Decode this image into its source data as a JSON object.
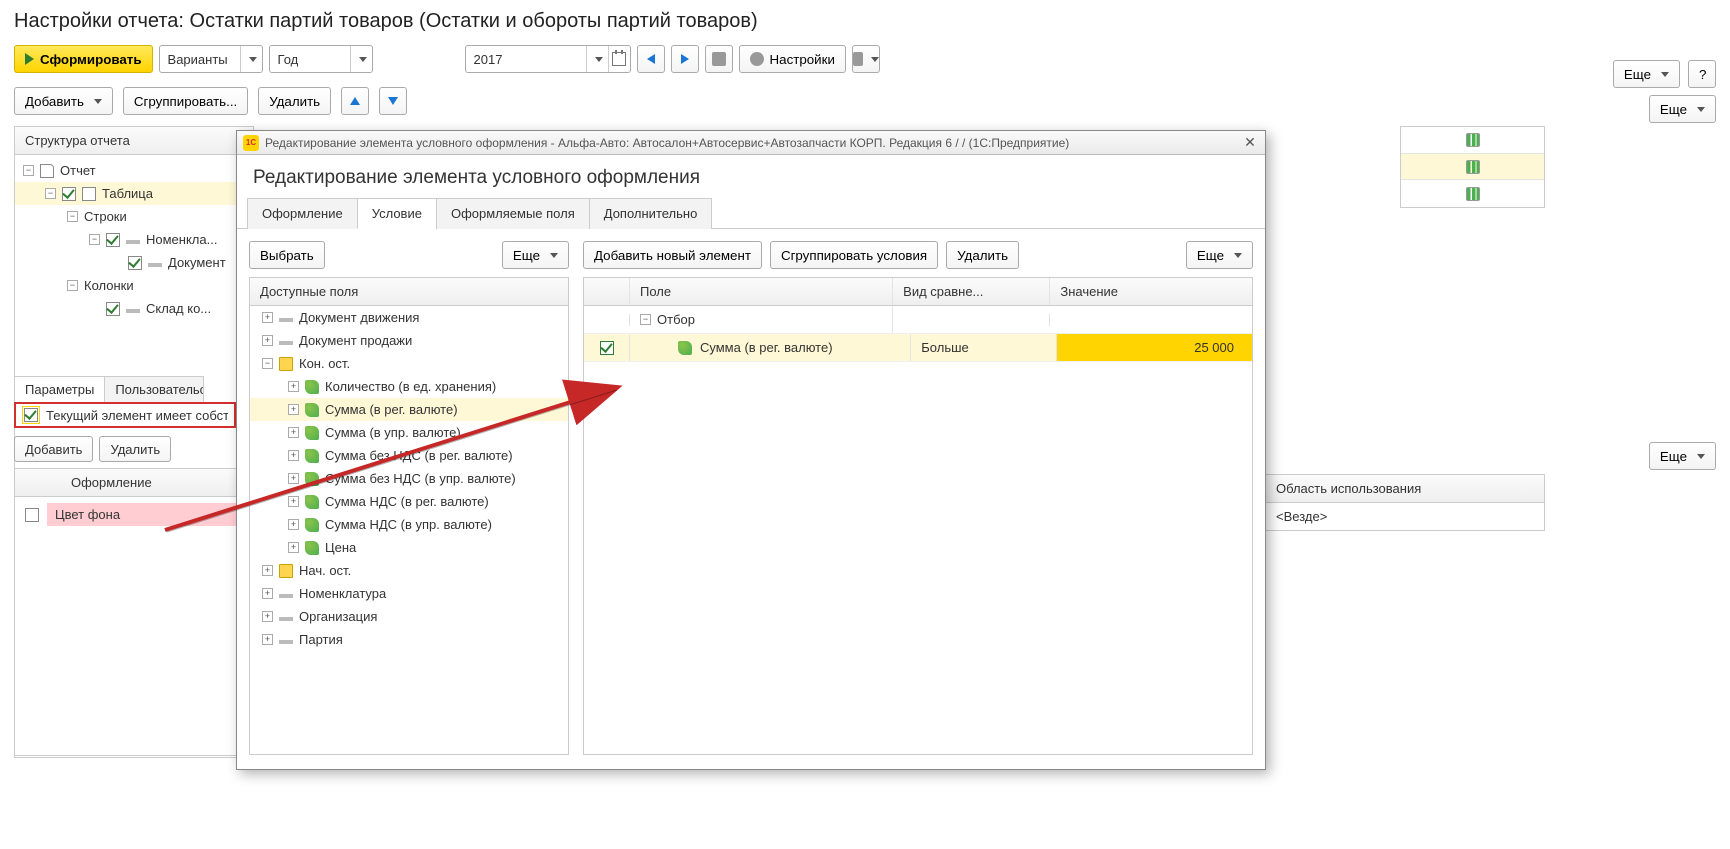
{
  "page_title": "Настройки отчета: Остатки партий товаров (Остатки и обороты партий товаров)",
  "main_toolbar": {
    "generate": "Сформировать",
    "variants": "Варианты",
    "period_type": "Год",
    "period_value": "2017",
    "settings": "Настройки",
    "more": "Еще",
    "help": "?"
  },
  "sub_toolbar": {
    "add": "Добавить",
    "group": "Сгруппировать...",
    "delete": "Удалить",
    "more": "Еще"
  },
  "structure": {
    "header": "Структура отчета",
    "items": [
      {
        "label": "Отчет",
        "level": 0,
        "icon": "doc-icon",
        "expand": "−"
      },
      {
        "label": "Таблица",
        "level": 1,
        "icon": "table-icon",
        "expand": "−",
        "checked": true,
        "selected": true
      },
      {
        "label": "Строки",
        "level": 2,
        "icon": "",
        "expand": "−"
      },
      {
        "label": "Номенклатура",
        "level": 3,
        "icon": "dash-icon",
        "expand": "−",
        "checked": true,
        "truncate": true
      },
      {
        "label": "Документ",
        "level": 4,
        "icon": "dash-icon",
        "checked": true,
        "truncate": true
      },
      {
        "label": "Колонки",
        "level": 2,
        "icon": "",
        "expand": "−"
      },
      {
        "label": "Склад компании",
        "level": 3,
        "icon": "dash-icon",
        "checked": true,
        "truncate": true
      }
    ]
  },
  "bg_tabs": {
    "params": "Параметры",
    "user": "Пользовательские"
  },
  "highlight_checkbox": "Текущий элемент имеет собственное",
  "bg_small": {
    "add": "Добавить",
    "delete": "Удалить"
  },
  "bg_format": {
    "header": "Оформление",
    "row": "Цвет фона"
  },
  "right_usage": {
    "header": "Область использования",
    "value": "<Везде>"
  },
  "dialog": {
    "titlebar": "Редактирование элемента условного оформления - Альфа-Авто: Автосалон+Автосервис+Автозапчасти КОРП. Редакция 6 /  /  (1С:Предприятие)",
    "heading": "Редактирование элемента условного оформления",
    "tabs": [
      "Оформление",
      "Условие",
      "Оформляемые поля",
      "Дополнительно"
    ],
    "active_tab": 1,
    "left": {
      "select_btn": "Выбрать",
      "more": "Еще",
      "header": "Доступные поля",
      "tree": [
        {
          "label": "Документ движения",
          "level": 0,
          "icon": "dash-icon",
          "expand": "+"
        },
        {
          "label": "Документ продажи",
          "level": 0,
          "icon": "dash-icon",
          "expand": "+"
        },
        {
          "label": "Кон. ост.",
          "level": 0,
          "icon": "folder-icon",
          "expand": "−"
        },
        {
          "label": "Количество (в ед. хранения)",
          "level": 1,
          "icon": "green-leaf",
          "expand": "+"
        },
        {
          "label": "Сумма (в рег. валюте)",
          "level": 1,
          "icon": "green-leaf",
          "expand": "+",
          "selected": true
        },
        {
          "label": "Сумма (в упр. валюте)",
          "level": 1,
          "icon": "green-leaf",
          "expand": "+"
        },
        {
          "label": "Сумма без НДС (в рег. валюте)",
          "level": 1,
          "icon": "green-leaf",
          "expand": "+"
        },
        {
          "label": "Сумма без НДС (в упр. валюте)",
          "level": 1,
          "icon": "green-leaf",
          "expand": "+"
        },
        {
          "label": "Сумма НДС (в рег. валюте)",
          "level": 1,
          "icon": "green-leaf",
          "expand": "+"
        },
        {
          "label": "Сумма НДС (в упр. валюте)",
          "level": 1,
          "icon": "green-leaf",
          "expand": "+"
        },
        {
          "label": "Цена",
          "level": 1,
          "icon": "green-leaf",
          "expand": "+"
        },
        {
          "label": "Нач. ост.",
          "level": 0,
          "icon": "folder-icon",
          "expand": "+"
        },
        {
          "label": "Номенклатура",
          "level": 0,
          "icon": "dash-icon",
          "expand": "+"
        },
        {
          "label": "Организация",
          "level": 0,
          "icon": "dash-icon",
          "expand": "+"
        },
        {
          "label": "Партия",
          "level": 0,
          "icon": "dash-icon",
          "expand": "+"
        }
      ]
    },
    "right": {
      "btns": {
        "add": "Добавить новый элемент",
        "group": "Сгруппировать условия",
        "delete": "Удалить",
        "more": "Еще"
      },
      "columns": {
        "field": "Поле",
        "compare": "Вид сравне...",
        "value": "Значение"
      },
      "root_label": "Отбор",
      "row": {
        "field": "Сумма (в рег. валюте)",
        "compare": "Больше",
        "value": "25 000"
      }
    }
  }
}
